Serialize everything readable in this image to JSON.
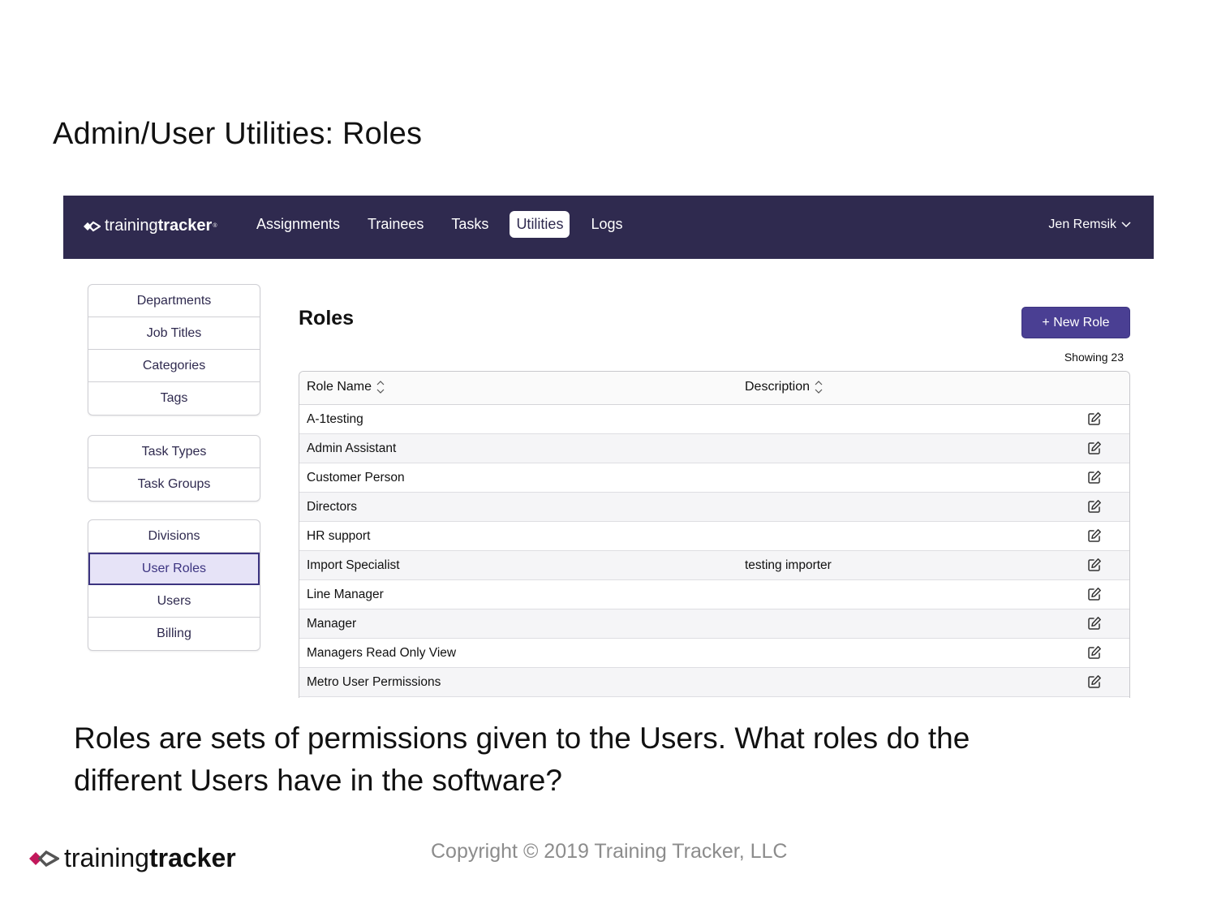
{
  "slide": {
    "title": "Admin/User Utilities: Roles",
    "caption": "Roles are sets of permissions given to the Users. What roles do the different Users have in the software?"
  },
  "app": {
    "brand_light": "training",
    "brand_bold": "tracker",
    "nav": [
      "Assignments",
      "Trainees",
      "Tasks",
      "Utilities",
      "Logs"
    ],
    "active_nav": "Utilities",
    "user": "Jen Remsik"
  },
  "sidebar": {
    "groups": [
      [
        "Departments",
        "Job Titles",
        "Categories",
        "Tags"
      ],
      [
        "Task Types",
        "Task Groups"
      ],
      [
        "Divisions",
        "User Roles",
        "Users",
        "Billing"
      ]
    ],
    "selected": "User Roles"
  },
  "main": {
    "heading": "Roles",
    "new_button": "+ New Role",
    "showing": "Showing 23",
    "columns": [
      "Role Name",
      "Description"
    ],
    "rows": [
      {
        "name": "A-1testing",
        "description": ""
      },
      {
        "name": "Admin Assistant",
        "description": ""
      },
      {
        "name": "Customer Person",
        "description": ""
      },
      {
        "name": "Directors",
        "description": ""
      },
      {
        "name": "HR support",
        "description": ""
      },
      {
        "name": "Import Specialist",
        "description": "testing importer"
      },
      {
        "name": "Line Manager",
        "description": ""
      },
      {
        "name": "Manager",
        "description": ""
      },
      {
        "name": "Managers Read Only View",
        "description": ""
      },
      {
        "name": "Metro User Permissions",
        "description": ""
      }
    ]
  },
  "footer": {
    "logo_light": "training",
    "logo_bold": "tracker",
    "copyright": "Copyright © 2019 Training Tracker, LLC"
  },
  "colors": {
    "nav_bg": "#2f2a4f",
    "accent": "#4a3f93",
    "selected_bg": "#e6e3f7",
    "logo_pink": "#c2185b"
  }
}
